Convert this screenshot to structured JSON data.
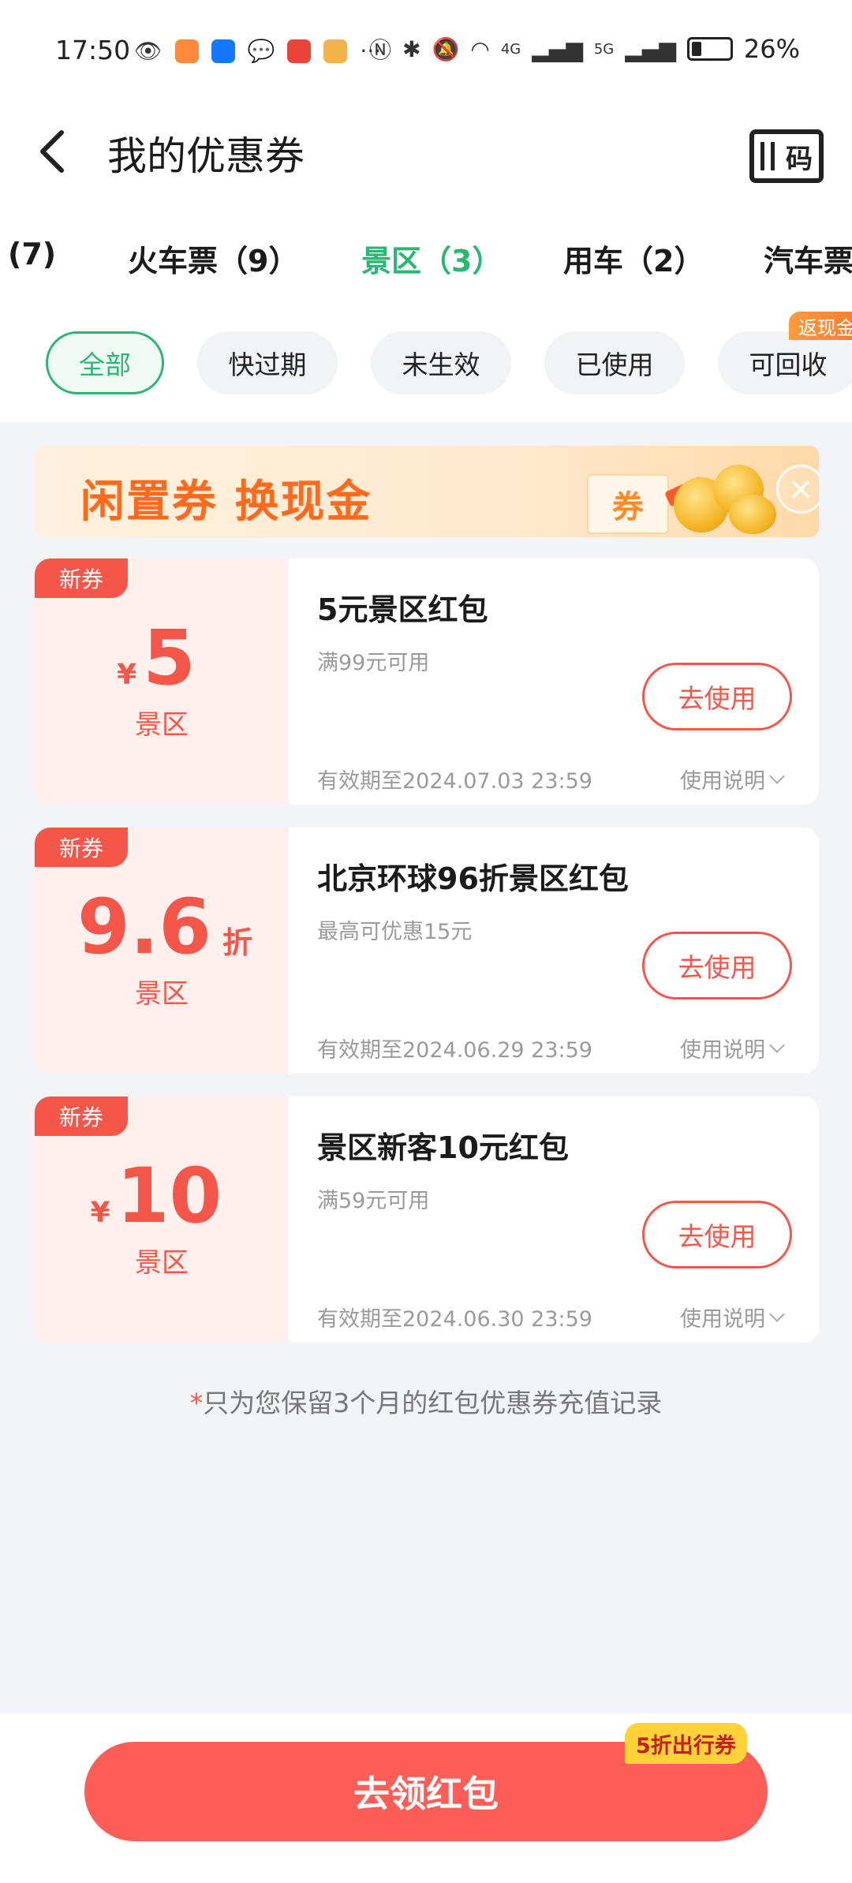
{
  "status_bar": {
    "time": "17:50",
    "battery": "26%",
    "net_a": "4G",
    "net_b": "5G",
    "more": "···"
  },
  "header": {
    "title": "我的优惠券",
    "code_label": "码"
  },
  "category_tabs": [
    {
      "label": "(7)"
    },
    {
      "label": "火车票（9）"
    },
    {
      "label": "景区（3）"
    },
    {
      "label": "用车（2）"
    },
    {
      "label": "汽车票"
    }
  ],
  "filters": {
    "chips": [
      {
        "label": "全部"
      },
      {
        "label": "快过期"
      },
      {
        "label": "未生效"
      },
      {
        "label": "已使用"
      },
      {
        "label": "可回收"
      }
    ],
    "badge": "返现金"
  },
  "banner": {
    "text": "闲置券 换现金",
    "ticket_label": "券"
  },
  "coupons": [
    {
      "badge": "新券",
      "unit_pre": "¥",
      "amount": "5",
      "unit_post": "",
      "category": "景区",
      "title": "5元景区红包",
      "condition": "满99元可用",
      "button": "去使用",
      "expire": "有效期至2024.07.03 23:59",
      "instructions": "使用说明"
    },
    {
      "badge": "新券",
      "unit_pre": "",
      "amount": "9.6",
      "unit_post": "折",
      "category": "景区",
      "title": "北京环球96折景区红包",
      "condition": "最高可优惠15元",
      "button": "去使用",
      "expire": "有效期至2024.06.29 23:59",
      "instructions": "使用说明"
    },
    {
      "badge": "新券",
      "unit_pre": "¥",
      "amount": "10",
      "unit_post": "",
      "category": "景区",
      "title": "景区新客10元红包",
      "condition": "满59元可用",
      "button": "去使用",
      "expire": "有效期至2024.06.30 23:59",
      "instructions": "使用说明"
    }
  ],
  "footer_note": {
    "star": "*",
    "text": "只为您保留3个月的红包优惠券充值记录"
  },
  "bottom": {
    "button": "去领红包",
    "badge": "5折出行券"
  },
  "colors": {
    "accent_green": "#2bb673",
    "coupon_red": "#f5564a",
    "claim_button": "#fe5e57",
    "badge_yellow": "#ffd23a"
  }
}
